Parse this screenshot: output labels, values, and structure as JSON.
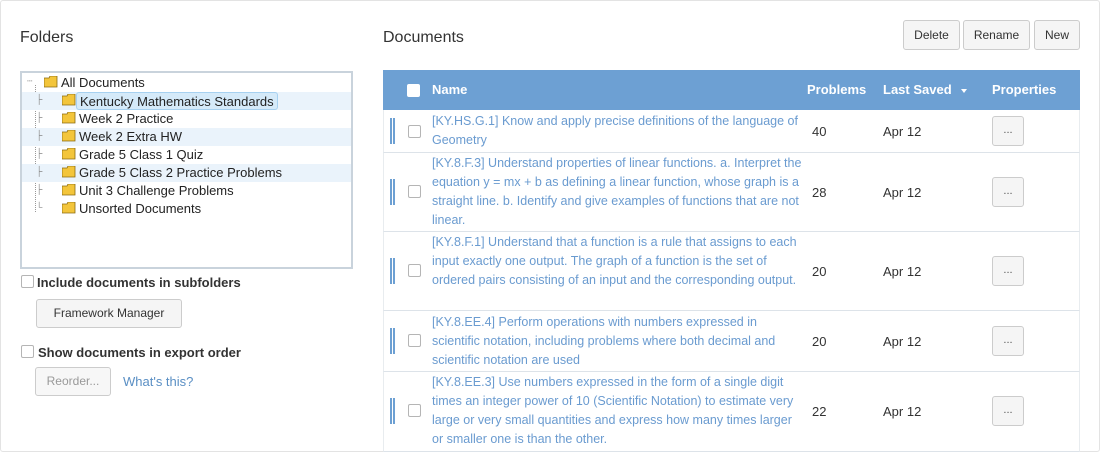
{
  "folders_panel": {
    "title": "Folders",
    "tree": [
      {
        "label": "All Documents"
      },
      {
        "label": "Kentucky Mathematics Standards"
      },
      {
        "label": "Week 2 Practice"
      },
      {
        "label": "Week 2 Extra HW"
      },
      {
        "label": "Grade 5 Class 1 Quiz"
      },
      {
        "label": "Grade 5 Class 2 Practice Problems"
      },
      {
        "label": "Unit 3 Challenge Problems"
      },
      {
        "label": "Unsorted Documents"
      }
    ],
    "include_subfolders_label": "Include documents in subfolders",
    "framework_manager_label": "Framework Manager",
    "export_order_label": "Show documents in export order",
    "reorder_label": "Reorder...",
    "whats_this_label": "What's this?"
  },
  "documents_panel": {
    "title": "Documents",
    "toolbar": {
      "delete": "Delete",
      "rename": "Rename",
      "new": "New"
    },
    "columns": {
      "name": "Name",
      "problems": "Problems",
      "last_saved": "Last Saved",
      "properties": "Properties"
    },
    "rows": [
      {
        "name": "[KY.HS.G.1] Know and apply precise definitions of the language of Geometry",
        "problems": "40",
        "last_saved": "Apr 12",
        "properties": "..."
      },
      {
        "name": "[KY.8.F.3] Understand properties of linear functions. a. Interpret the equation y = mx + b as defining a linear function, whose graph is a straight line. b. Identify and give examples of functions that are not linear.",
        "problems": "28",
        "last_saved": "Apr 12",
        "properties": "..."
      },
      {
        "name": "[KY.8.F.1] Understand that a function is a rule that assigns to each input exactly one output. The graph of a function is the set of ordered pairs consisting of an input and the corresponding output.",
        "problems": "20",
        "last_saved": "Apr 12",
        "properties": "..."
      },
      {
        "name": "[KY.8.EE.4] Perform operations with numbers expressed in scientific notation, including problems where both decimal and scientific notation are used",
        "problems": "20",
        "last_saved": "Apr 12",
        "properties": "..."
      },
      {
        "name": "[KY.8.EE.3] Use numbers expressed in the form of a single digit times an integer power of 10 (Scientific Notation) to estimate very large or very small quantities and express how many times larger or smaller one is than the other.",
        "problems": "22",
        "last_saved": "Apr 12",
        "properties": "..."
      }
    ]
  },
  "colors": {
    "header_blue": "#6da0d3",
    "link_blue": "#6a9bd0",
    "selection": "#d5eaf9"
  },
  "icons": [
    "folder-icon",
    "tree-expander-icon",
    "sort-caret-icon",
    "drag-grip-icon"
  ]
}
